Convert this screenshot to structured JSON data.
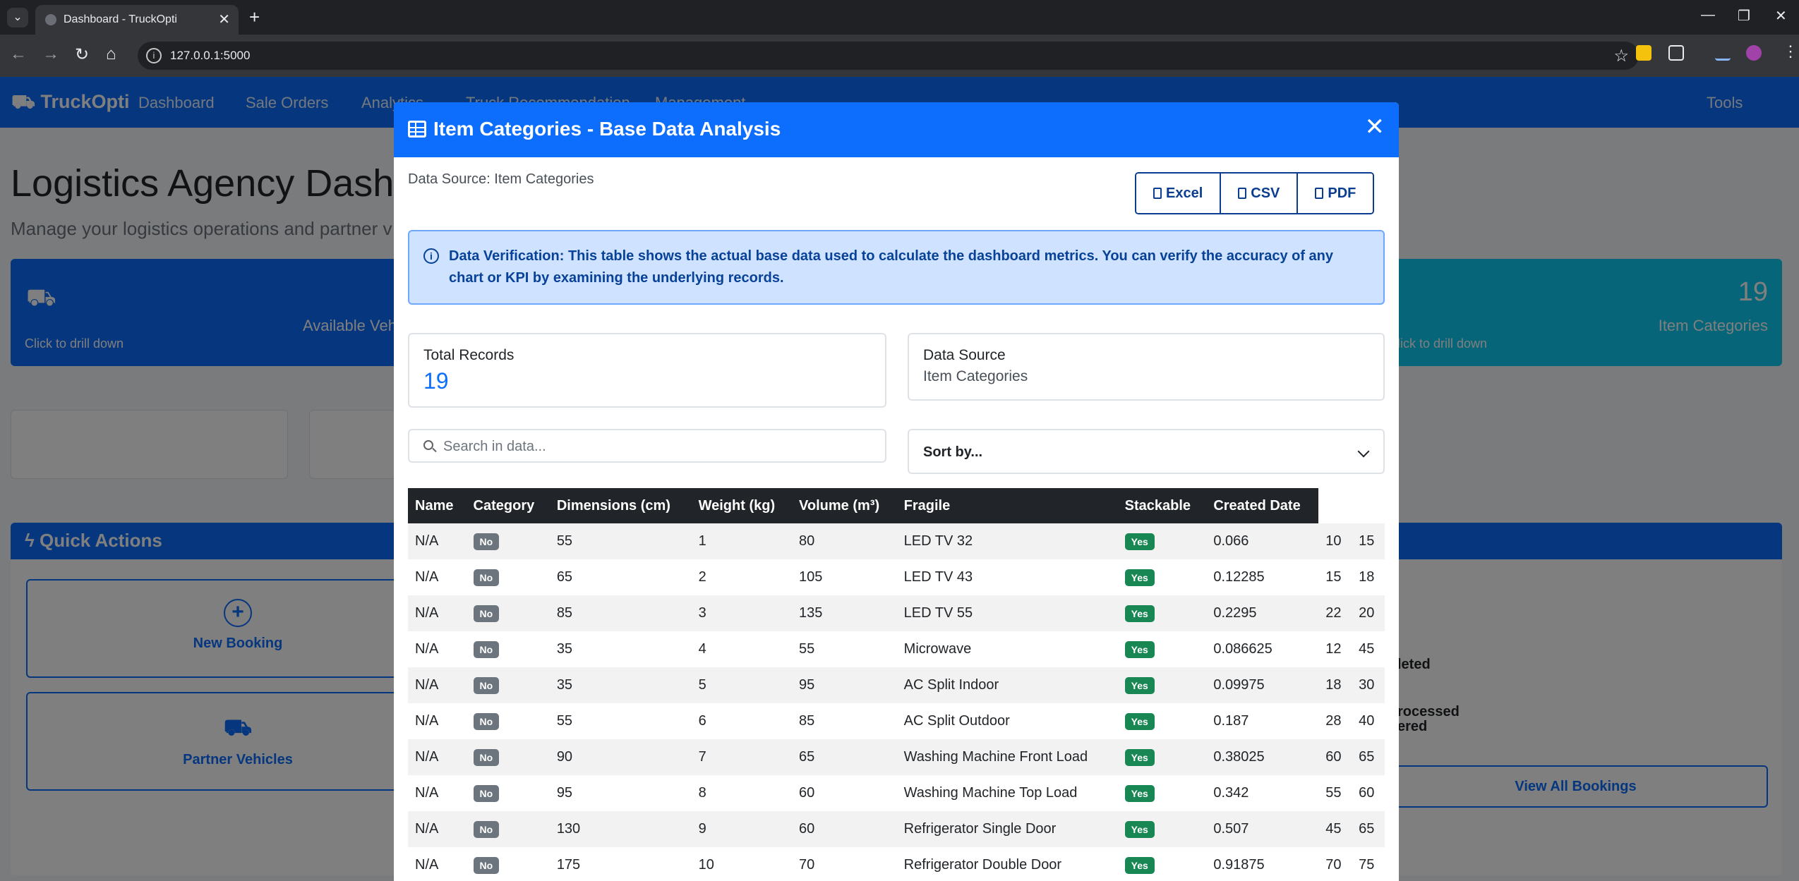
{
  "browser": {
    "tab_title": "Dashboard - TruckOpti",
    "url": "127.0.0.1:5000"
  },
  "app": {
    "brand": "TruckOpti",
    "nav": {
      "dashboard": "Dashboard",
      "sale_orders": "Sale Orders",
      "analytics": "Analytics",
      "truck_recommendation": "Truck Recommendation",
      "management": "Management",
      "tools": "Tools"
    },
    "page_title": "Logistics Agency Dash",
    "page_subtitle": "Manage your logistics operations and partner v",
    "card_blue": {
      "label": "Available Vehi",
      "drill": "Click to drill down"
    },
    "card_teal": {
      "value": "19",
      "label": "Item Categories",
      "drill": "lick to drill down"
    },
    "quick_actions": {
      "title": "Quick Actions",
      "new_booking": "New Booking",
      "partner_vehicles": "Partner Vehicles"
    },
    "bookings": {
      "line1": "leted",
      "line2": "ered",
      "line3": "rocessed",
      "view_all": "View All Bookings"
    }
  },
  "modal": {
    "title": "Item Categories - Base Data Analysis",
    "data_source_line": "Data Source: Item Categories",
    "export": {
      "excel": "Excel",
      "csv": "CSV",
      "pdf": "PDF"
    },
    "alert": {
      "strong": "Data Verification:",
      "text": "This table shows the actual base data used to calculate the dashboard metrics. You can verify the accuracy of any chart or KPI by examining the underlying records."
    },
    "total_records": {
      "label": "Total Records",
      "value": "19"
    },
    "data_source": {
      "label": "Data Source",
      "value": "Item Categories"
    },
    "search_placeholder": "Search in data...",
    "sort_placeholder": "Sort by...",
    "columns": [
      "Name",
      "Category",
      "Dimensions (cm)",
      "Weight (kg)",
      "Volume (m³)",
      "Fragile",
      "Stackable",
      "Created Date"
    ],
    "rows": [
      [
        "N/A",
        "No",
        "55",
        "1",
        "80",
        "LED TV 32",
        "Yes",
        "0.066",
        "10",
        "15"
      ],
      [
        "N/A",
        "No",
        "65",
        "2",
        "105",
        "LED TV 43",
        "Yes",
        "0.12285",
        "15",
        "18"
      ],
      [
        "N/A",
        "No",
        "85",
        "3",
        "135",
        "LED TV 55",
        "Yes",
        "0.2295",
        "22",
        "20"
      ],
      [
        "N/A",
        "No",
        "35",
        "4",
        "55",
        "Microwave",
        "Yes",
        "0.086625",
        "12",
        "45"
      ],
      [
        "N/A",
        "No",
        "35",
        "5",
        "95",
        "AC Split Indoor",
        "Yes",
        "0.09975",
        "18",
        "30"
      ],
      [
        "N/A",
        "No",
        "55",
        "6",
        "85",
        "AC Split Outdoor",
        "Yes",
        "0.187",
        "28",
        "40"
      ],
      [
        "N/A",
        "No",
        "90",
        "7",
        "65",
        "Washing Machine Front Load",
        "Yes",
        "0.38025",
        "60",
        "65"
      ],
      [
        "N/A",
        "No",
        "95",
        "8",
        "60",
        "Washing Machine Top Load",
        "Yes",
        "0.342",
        "55",
        "60"
      ],
      [
        "N/A",
        "No",
        "130",
        "9",
        "60",
        "Refrigerator Single Door",
        "Yes",
        "0.507",
        "45",
        "65"
      ],
      [
        "N/A",
        "No",
        "175",
        "10",
        "70",
        "Refrigerator Double Door",
        "Yes",
        "0.91875",
        "70",
        "75"
      ]
    ]
  },
  "colors": {
    "primary": "#0d6efd",
    "info": "#0dcaf0",
    "badge_no": "#6c757d",
    "badge_yes": "#198754",
    "alert_bg": "#cfe2ff",
    "table_header": "#212529"
  }
}
